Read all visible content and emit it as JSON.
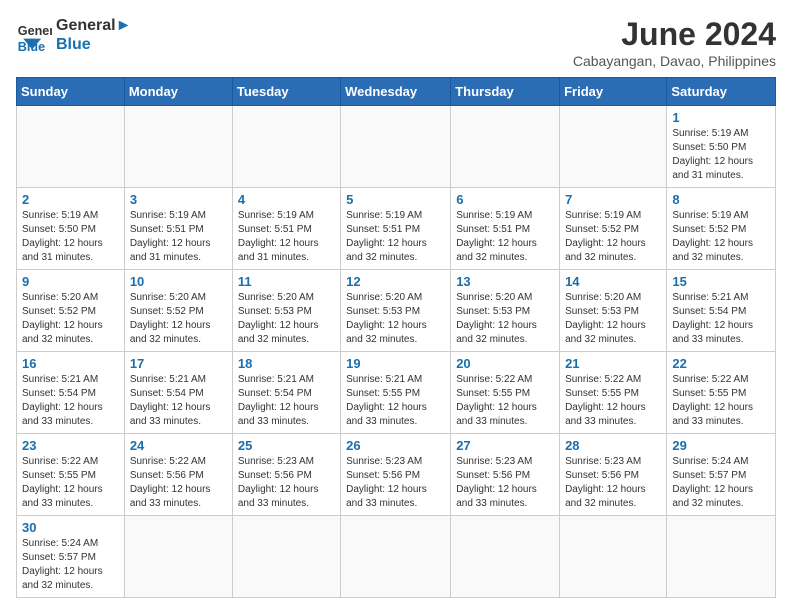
{
  "header": {
    "logo_general": "General",
    "logo_blue": "Blue",
    "month_title": "June 2024",
    "location": "Cabayangan, Davao, Philippines"
  },
  "weekdays": [
    "Sunday",
    "Monday",
    "Tuesday",
    "Wednesday",
    "Thursday",
    "Friday",
    "Saturday"
  ],
  "days": {
    "1": {
      "sunrise": "5:19 AM",
      "sunset": "5:50 PM",
      "daylight": "12 hours and 31 minutes."
    },
    "2": {
      "sunrise": "5:19 AM",
      "sunset": "5:50 PM",
      "daylight": "12 hours and 31 minutes."
    },
    "3": {
      "sunrise": "5:19 AM",
      "sunset": "5:51 PM",
      "daylight": "12 hours and 31 minutes."
    },
    "4": {
      "sunrise": "5:19 AM",
      "sunset": "5:51 PM",
      "daylight": "12 hours and 31 minutes."
    },
    "5": {
      "sunrise": "5:19 AM",
      "sunset": "5:51 PM",
      "daylight": "12 hours and 32 minutes."
    },
    "6": {
      "sunrise": "5:19 AM",
      "sunset": "5:51 PM",
      "daylight": "12 hours and 32 minutes."
    },
    "7": {
      "sunrise": "5:19 AM",
      "sunset": "5:52 PM",
      "daylight": "12 hours and 32 minutes."
    },
    "8": {
      "sunrise": "5:19 AM",
      "sunset": "5:52 PM",
      "daylight": "12 hours and 32 minutes."
    },
    "9": {
      "sunrise": "5:20 AM",
      "sunset": "5:52 PM",
      "daylight": "12 hours and 32 minutes."
    },
    "10": {
      "sunrise": "5:20 AM",
      "sunset": "5:52 PM",
      "daylight": "12 hours and 32 minutes."
    },
    "11": {
      "sunrise": "5:20 AM",
      "sunset": "5:53 PM",
      "daylight": "12 hours and 32 minutes."
    },
    "12": {
      "sunrise": "5:20 AM",
      "sunset": "5:53 PM",
      "daylight": "12 hours and 32 minutes."
    },
    "13": {
      "sunrise": "5:20 AM",
      "sunset": "5:53 PM",
      "daylight": "12 hours and 32 minutes."
    },
    "14": {
      "sunrise": "5:20 AM",
      "sunset": "5:53 PM",
      "daylight": "12 hours and 32 minutes."
    },
    "15": {
      "sunrise": "5:21 AM",
      "sunset": "5:54 PM",
      "daylight": "12 hours and 33 minutes."
    },
    "16": {
      "sunrise": "5:21 AM",
      "sunset": "5:54 PM",
      "daylight": "12 hours and 33 minutes."
    },
    "17": {
      "sunrise": "5:21 AM",
      "sunset": "5:54 PM",
      "daylight": "12 hours and 33 minutes."
    },
    "18": {
      "sunrise": "5:21 AM",
      "sunset": "5:54 PM",
      "daylight": "12 hours and 33 minutes."
    },
    "19": {
      "sunrise": "5:21 AM",
      "sunset": "5:55 PM",
      "daylight": "12 hours and 33 minutes."
    },
    "20": {
      "sunrise": "5:22 AM",
      "sunset": "5:55 PM",
      "daylight": "12 hours and 33 minutes."
    },
    "21": {
      "sunrise": "5:22 AM",
      "sunset": "5:55 PM",
      "daylight": "12 hours and 33 minutes."
    },
    "22": {
      "sunrise": "5:22 AM",
      "sunset": "5:55 PM",
      "daylight": "12 hours and 33 minutes."
    },
    "23": {
      "sunrise": "5:22 AM",
      "sunset": "5:55 PM",
      "daylight": "12 hours and 33 minutes."
    },
    "24": {
      "sunrise": "5:22 AM",
      "sunset": "5:56 PM",
      "daylight": "12 hours and 33 minutes."
    },
    "25": {
      "sunrise": "5:23 AM",
      "sunset": "5:56 PM",
      "daylight": "12 hours and 33 minutes."
    },
    "26": {
      "sunrise": "5:23 AM",
      "sunset": "5:56 PM",
      "daylight": "12 hours and 33 minutes."
    },
    "27": {
      "sunrise": "5:23 AM",
      "sunset": "5:56 PM",
      "daylight": "12 hours and 33 minutes."
    },
    "28": {
      "sunrise": "5:23 AM",
      "sunset": "5:56 PM",
      "daylight": "12 hours and 32 minutes."
    },
    "29": {
      "sunrise": "5:24 AM",
      "sunset": "5:57 PM",
      "daylight": "12 hours and 32 minutes."
    },
    "30": {
      "sunrise": "5:24 AM",
      "sunset": "5:57 PM",
      "daylight": "12 hours and 32 minutes."
    }
  }
}
